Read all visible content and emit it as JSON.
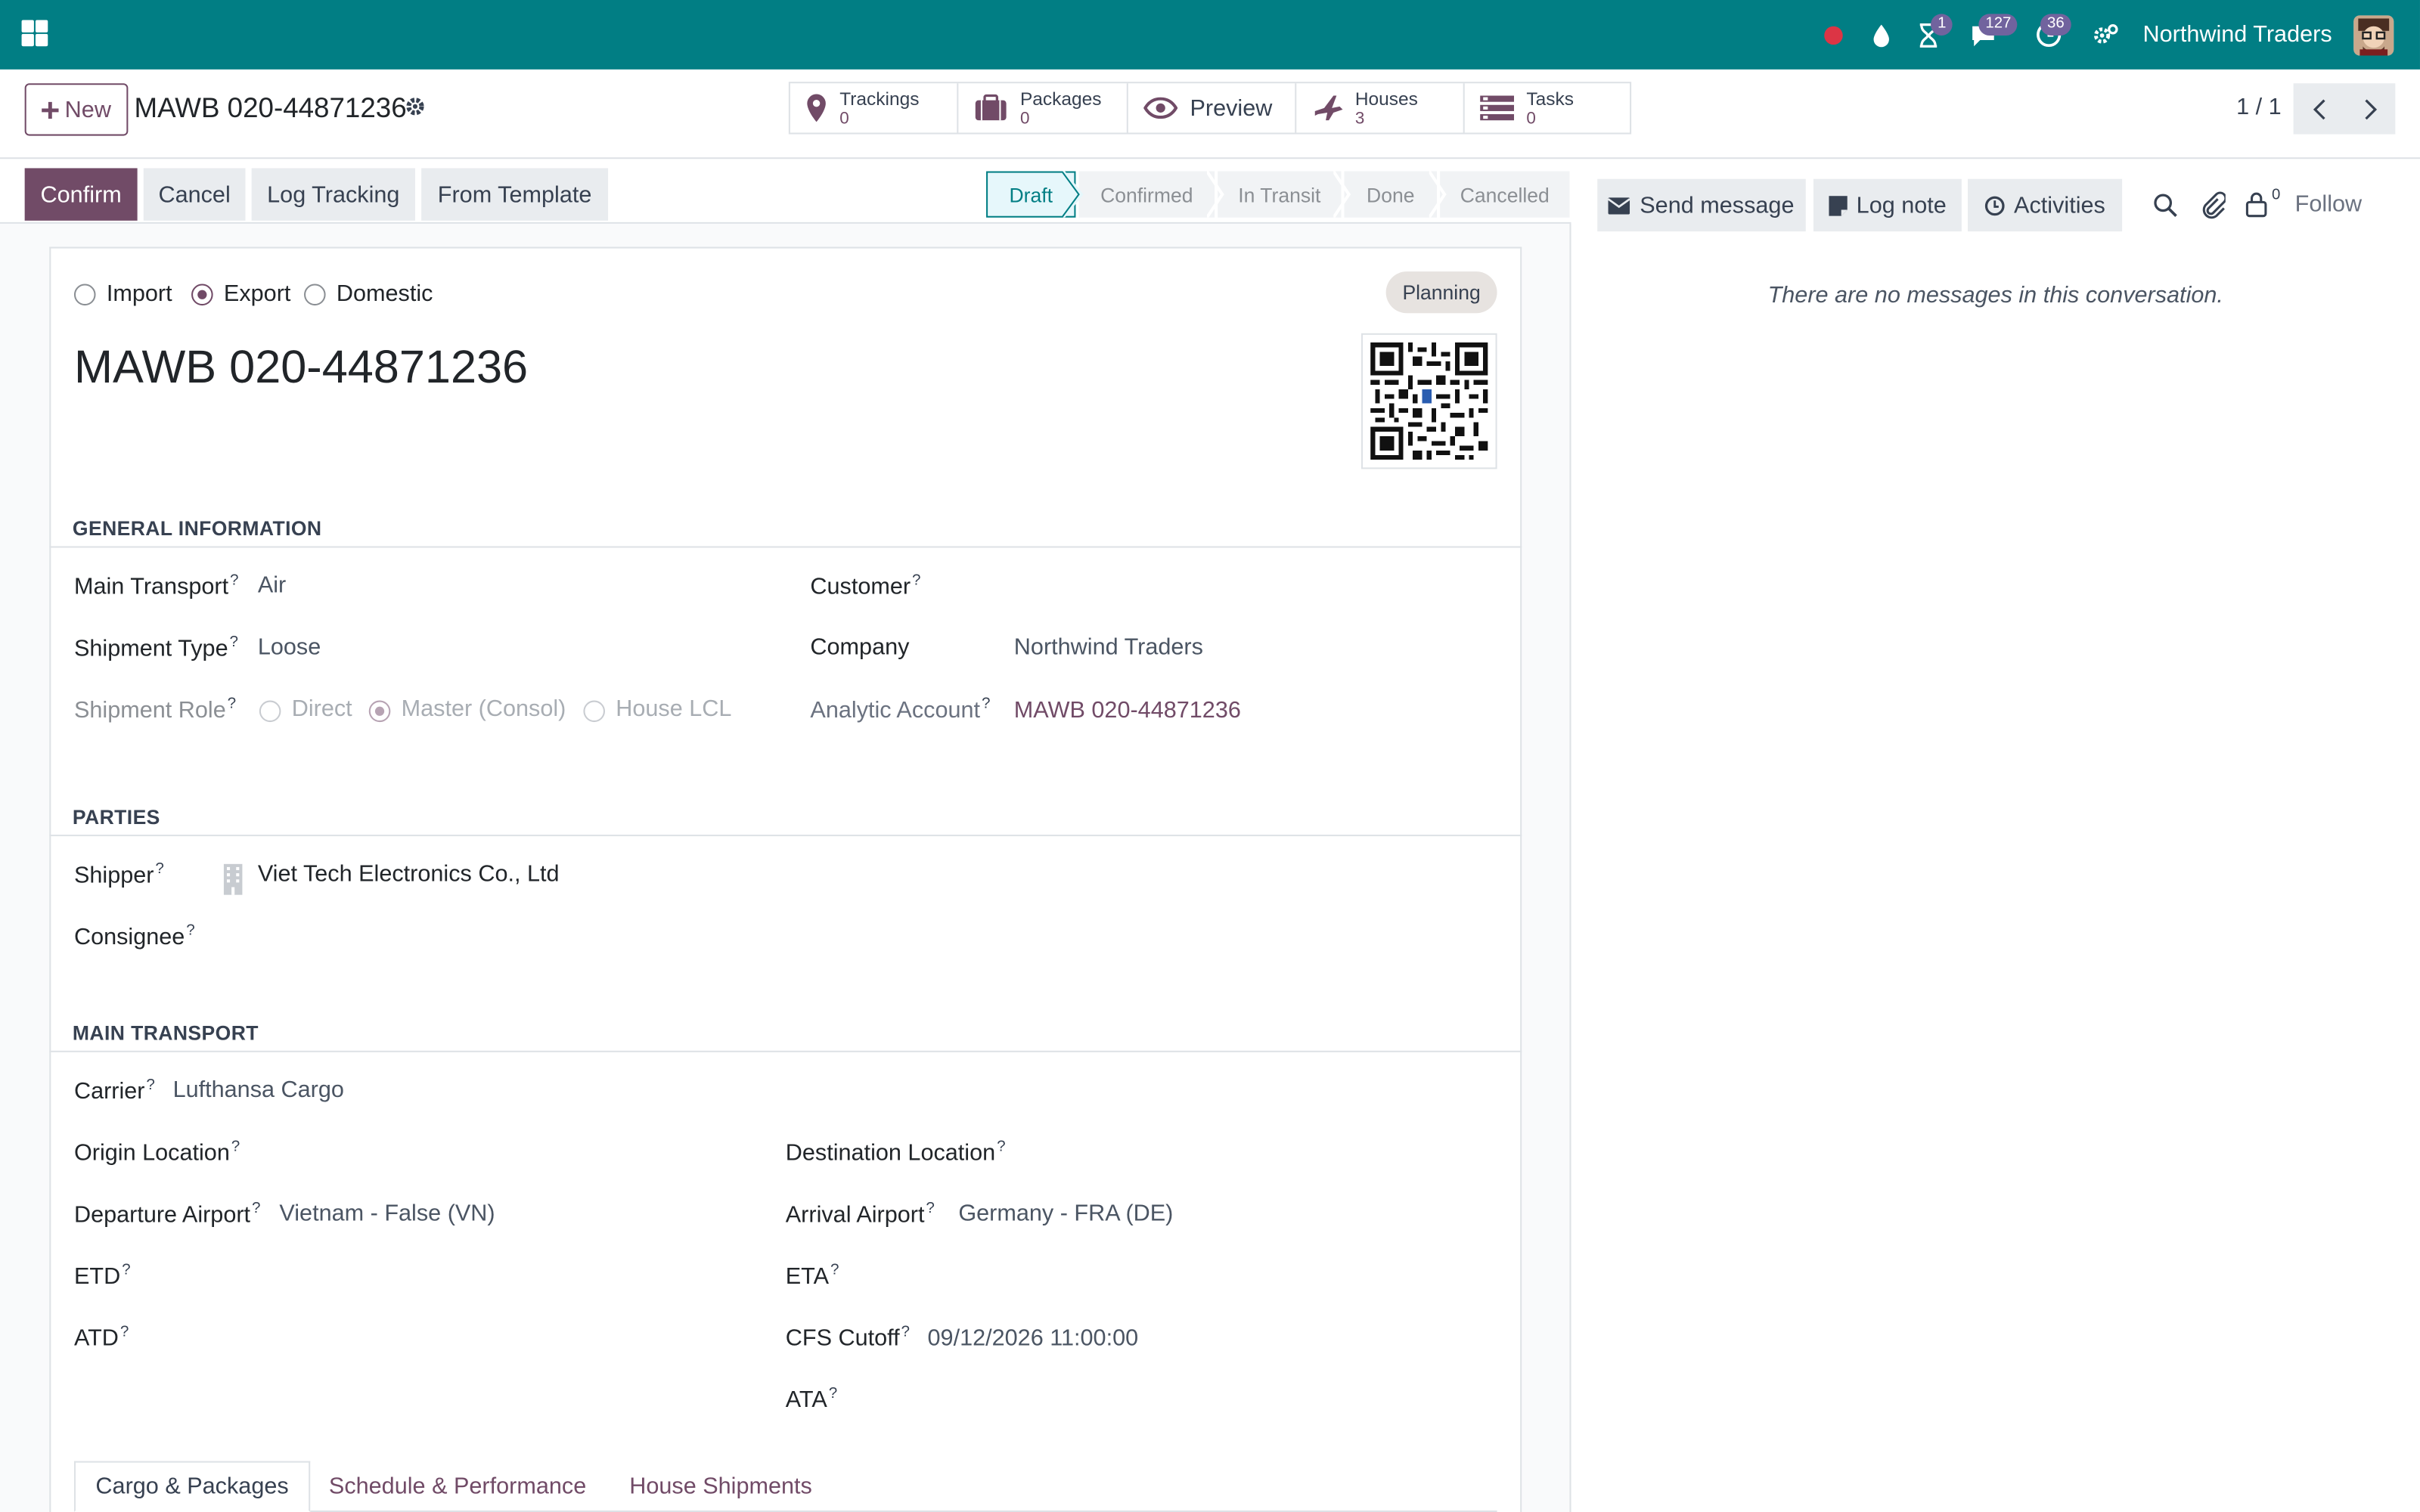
{
  "navbar": {
    "company": "Northwind Traders",
    "badges": {
      "activities": "1",
      "messages": "127",
      "clock": "36"
    },
    "colors": {
      "bar": "#017e84",
      "badge": "#71639e"
    }
  },
  "control_panel": {
    "new_label": "New",
    "record_title": "MAWB 020-44871236",
    "smart_buttons": [
      {
        "label": "Trackings",
        "count": "0",
        "icon": "map-pin-icon"
      },
      {
        "label": "Packages",
        "count": "0",
        "icon": "suitcase-icon"
      },
      {
        "label": "Preview",
        "icon": "eye-icon"
      },
      {
        "label": "Houses",
        "count": "3",
        "icon": "plane-icon"
      },
      {
        "label": "Tasks",
        "count": "0",
        "icon": "tasks-icon"
      }
    ],
    "pager": "1 / 1"
  },
  "actions": {
    "confirm": "Confirm",
    "cancel": "Cancel",
    "log_tracking": "Log Tracking",
    "from_template": "From Template"
  },
  "stages": [
    "Draft",
    "Confirmed",
    "In Transit",
    "Done",
    "Cancelled"
  ],
  "active_stage": "Draft",
  "form": {
    "direction_options": [
      "Import",
      "Export",
      "Domestic"
    ],
    "direction_selected": "Export",
    "planning_badge": "Planning",
    "title": "MAWB 020-44871236",
    "general": {
      "heading": "GENERAL INFORMATION",
      "main_transport_label": "Main Transport",
      "main_transport": "Air",
      "shipment_type_label": "Shipment Type",
      "shipment_type": "Loose",
      "shipment_role_label": "Shipment Role",
      "role_options": [
        "Direct",
        "Master (Consol)",
        "House LCL"
      ],
      "role_selected": "Master (Consol)",
      "customer_label": "Customer",
      "company_label": "Company",
      "company": "Northwind Traders",
      "analytic_label": "Analytic Account",
      "analytic": "MAWB 020-44871236"
    },
    "parties": {
      "heading": "PARTIES",
      "shipper_label": "Shipper",
      "shipper": "Viet Tech Electronics Co., Ltd",
      "consignee_label": "Consignee"
    },
    "transport": {
      "heading": "MAIN TRANSPORT",
      "carrier_label": "Carrier",
      "carrier": "Lufthansa Cargo",
      "origin_label": "Origin Location",
      "destination_label": "Destination Location",
      "departure_label": "Departure Airport",
      "departure": "Vietnam - False (VN)",
      "arrival_label": "Arrival Airport",
      "arrival": "Germany - FRA (DE)",
      "etd_label": "ETD",
      "eta_label": "ETA",
      "atd_label": "ATD",
      "cfs_label": "CFS Cutoff",
      "cfs": "09/12/2026 11:00:00",
      "ata_label": "ATA"
    },
    "tabs": [
      "Cargo & Packages",
      "Schedule & Performance",
      "House Shipments"
    ],
    "active_tab": "Cargo & Packages"
  },
  "chatter": {
    "send_message": "Send message",
    "log_note": "Log note",
    "activities": "Activities",
    "followers_count": "0",
    "follow": "Follow",
    "empty": "There are no messages in this conversation."
  },
  "theme": {
    "primary": "#714b67",
    "teal": "#017e84"
  }
}
